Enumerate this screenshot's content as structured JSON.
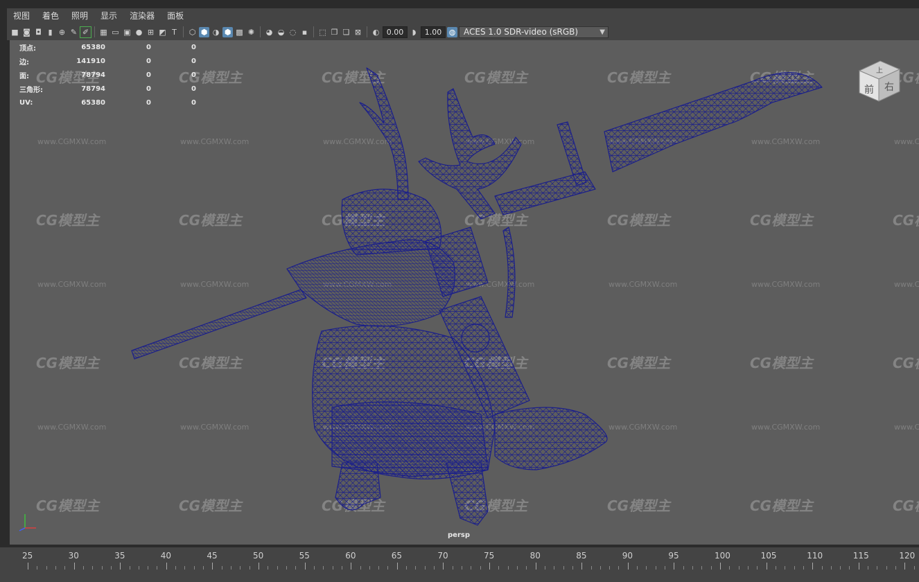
{
  "menu": [
    "视图",
    "着色",
    "照明",
    "显示",
    "渲染器",
    "面板"
  ],
  "toolbar": {
    "field1": "0.00",
    "field2": "1.00",
    "colorspace": "ACES 1.0 SDR-video (sRGB)"
  },
  "hud": [
    {
      "label": "顶点:",
      "v1": "65380",
      "v2": "0",
      "v3": "0"
    },
    {
      "label": "边:",
      "v1": "141910",
      "v2": "0",
      "v3": "0"
    },
    {
      "label": "面:",
      "v1": "78794",
      "v2": "0",
      "v3": "0"
    },
    {
      "label": "三角形:",
      "v1": "78794",
      "v2": "0",
      "v3": "0"
    },
    {
      "label": "UV:",
      "v1": "65380",
      "v2": "0",
      "v3": "0"
    }
  ],
  "viewport": {
    "camera": "persp",
    "watermark": "CG模型主",
    "watermark_url": "www.CGMXW.com"
  },
  "viewcube": {
    "front": "前",
    "right": "右",
    "top": "上"
  },
  "timeline": {
    "ticks": [
      "25",
      "30",
      "35",
      "40",
      "45",
      "50",
      "55",
      "60",
      "65",
      "70",
      "75",
      "80",
      "85",
      "90",
      "95",
      "100",
      "105",
      "110",
      "115",
      "120"
    ]
  },
  "colors": {
    "viewport_bg": "#5d5d5d",
    "wireframe": "#1b1f8a",
    "menubar": "#444444"
  }
}
